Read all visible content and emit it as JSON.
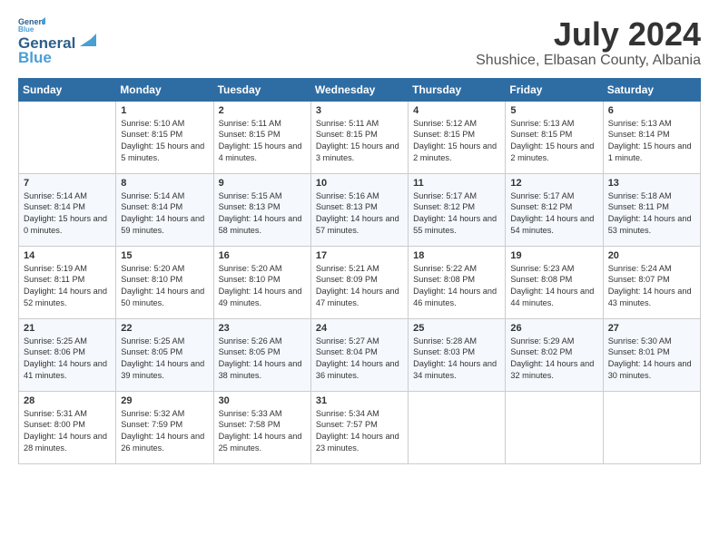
{
  "logo": {
    "line1": "General",
    "line2": "Blue"
  },
  "title": "July 2024",
  "location": "Shushice, Elbasan County, Albania",
  "weekdays": [
    "Sunday",
    "Monday",
    "Tuesday",
    "Wednesday",
    "Thursday",
    "Friday",
    "Saturday"
  ],
  "weeks": [
    [
      {
        "day": "",
        "sunrise": "",
        "sunset": "",
        "daylight": ""
      },
      {
        "day": "1",
        "sunrise": "Sunrise: 5:10 AM",
        "sunset": "Sunset: 8:15 PM",
        "daylight": "Daylight: 15 hours and 5 minutes."
      },
      {
        "day": "2",
        "sunrise": "Sunrise: 5:11 AM",
        "sunset": "Sunset: 8:15 PM",
        "daylight": "Daylight: 15 hours and 4 minutes."
      },
      {
        "day": "3",
        "sunrise": "Sunrise: 5:11 AM",
        "sunset": "Sunset: 8:15 PM",
        "daylight": "Daylight: 15 hours and 3 minutes."
      },
      {
        "day": "4",
        "sunrise": "Sunrise: 5:12 AM",
        "sunset": "Sunset: 8:15 PM",
        "daylight": "Daylight: 15 hours and 2 minutes."
      },
      {
        "day": "5",
        "sunrise": "Sunrise: 5:13 AM",
        "sunset": "Sunset: 8:15 PM",
        "daylight": "Daylight: 15 hours and 2 minutes."
      },
      {
        "day": "6",
        "sunrise": "Sunrise: 5:13 AM",
        "sunset": "Sunset: 8:14 PM",
        "daylight": "Daylight: 15 hours and 1 minute."
      }
    ],
    [
      {
        "day": "7",
        "sunrise": "Sunrise: 5:14 AM",
        "sunset": "Sunset: 8:14 PM",
        "daylight": "Daylight: 15 hours and 0 minutes."
      },
      {
        "day": "8",
        "sunrise": "Sunrise: 5:14 AM",
        "sunset": "Sunset: 8:14 PM",
        "daylight": "Daylight: 14 hours and 59 minutes."
      },
      {
        "day": "9",
        "sunrise": "Sunrise: 5:15 AM",
        "sunset": "Sunset: 8:13 PM",
        "daylight": "Daylight: 14 hours and 58 minutes."
      },
      {
        "day": "10",
        "sunrise": "Sunrise: 5:16 AM",
        "sunset": "Sunset: 8:13 PM",
        "daylight": "Daylight: 14 hours and 57 minutes."
      },
      {
        "day": "11",
        "sunrise": "Sunrise: 5:17 AM",
        "sunset": "Sunset: 8:12 PM",
        "daylight": "Daylight: 14 hours and 55 minutes."
      },
      {
        "day": "12",
        "sunrise": "Sunrise: 5:17 AM",
        "sunset": "Sunset: 8:12 PM",
        "daylight": "Daylight: 14 hours and 54 minutes."
      },
      {
        "day": "13",
        "sunrise": "Sunrise: 5:18 AM",
        "sunset": "Sunset: 8:11 PM",
        "daylight": "Daylight: 14 hours and 53 minutes."
      }
    ],
    [
      {
        "day": "14",
        "sunrise": "Sunrise: 5:19 AM",
        "sunset": "Sunset: 8:11 PM",
        "daylight": "Daylight: 14 hours and 52 minutes."
      },
      {
        "day": "15",
        "sunrise": "Sunrise: 5:20 AM",
        "sunset": "Sunset: 8:10 PM",
        "daylight": "Daylight: 14 hours and 50 minutes."
      },
      {
        "day": "16",
        "sunrise": "Sunrise: 5:20 AM",
        "sunset": "Sunset: 8:10 PM",
        "daylight": "Daylight: 14 hours and 49 minutes."
      },
      {
        "day": "17",
        "sunrise": "Sunrise: 5:21 AM",
        "sunset": "Sunset: 8:09 PM",
        "daylight": "Daylight: 14 hours and 47 minutes."
      },
      {
        "day": "18",
        "sunrise": "Sunrise: 5:22 AM",
        "sunset": "Sunset: 8:08 PM",
        "daylight": "Daylight: 14 hours and 46 minutes."
      },
      {
        "day": "19",
        "sunrise": "Sunrise: 5:23 AM",
        "sunset": "Sunset: 8:08 PM",
        "daylight": "Daylight: 14 hours and 44 minutes."
      },
      {
        "day": "20",
        "sunrise": "Sunrise: 5:24 AM",
        "sunset": "Sunset: 8:07 PM",
        "daylight": "Daylight: 14 hours and 43 minutes."
      }
    ],
    [
      {
        "day": "21",
        "sunrise": "Sunrise: 5:25 AM",
        "sunset": "Sunset: 8:06 PM",
        "daylight": "Daylight: 14 hours and 41 minutes."
      },
      {
        "day": "22",
        "sunrise": "Sunrise: 5:25 AM",
        "sunset": "Sunset: 8:05 PM",
        "daylight": "Daylight: 14 hours and 39 minutes."
      },
      {
        "day": "23",
        "sunrise": "Sunrise: 5:26 AM",
        "sunset": "Sunset: 8:05 PM",
        "daylight": "Daylight: 14 hours and 38 minutes."
      },
      {
        "day": "24",
        "sunrise": "Sunrise: 5:27 AM",
        "sunset": "Sunset: 8:04 PM",
        "daylight": "Daylight: 14 hours and 36 minutes."
      },
      {
        "day": "25",
        "sunrise": "Sunrise: 5:28 AM",
        "sunset": "Sunset: 8:03 PM",
        "daylight": "Daylight: 14 hours and 34 minutes."
      },
      {
        "day": "26",
        "sunrise": "Sunrise: 5:29 AM",
        "sunset": "Sunset: 8:02 PM",
        "daylight": "Daylight: 14 hours and 32 minutes."
      },
      {
        "day": "27",
        "sunrise": "Sunrise: 5:30 AM",
        "sunset": "Sunset: 8:01 PM",
        "daylight": "Daylight: 14 hours and 30 minutes."
      }
    ],
    [
      {
        "day": "28",
        "sunrise": "Sunrise: 5:31 AM",
        "sunset": "Sunset: 8:00 PM",
        "daylight": "Daylight: 14 hours and 28 minutes."
      },
      {
        "day": "29",
        "sunrise": "Sunrise: 5:32 AM",
        "sunset": "Sunset: 7:59 PM",
        "daylight": "Daylight: 14 hours and 26 minutes."
      },
      {
        "day": "30",
        "sunrise": "Sunrise: 5:33 AM",
        "sunset": "Sunset: 7:58 PM",
        "daylight": "Daylight: 14 hours and 25 minutes."
      },
      {
        "day": "31",
        "sunrise": "Sunrise: 5:34 AM",
        "sunset": "Sunset: 7:57 PM",
        "daylight": "Daylight: 14 hours and 23 minutes."
      },
      {
        "day": "",
        "sunrise": "",
        "sunset": "",
        "daylight": ""
      },
      {
        "day": "",
        "sunrise": "",
        "sunset": "",
        "daylight": ""
      },
      {
        "day": "",
        "sunrise": "",
        "sunset": "",
        "daylight": ""
      }
    ]
  ]
}
